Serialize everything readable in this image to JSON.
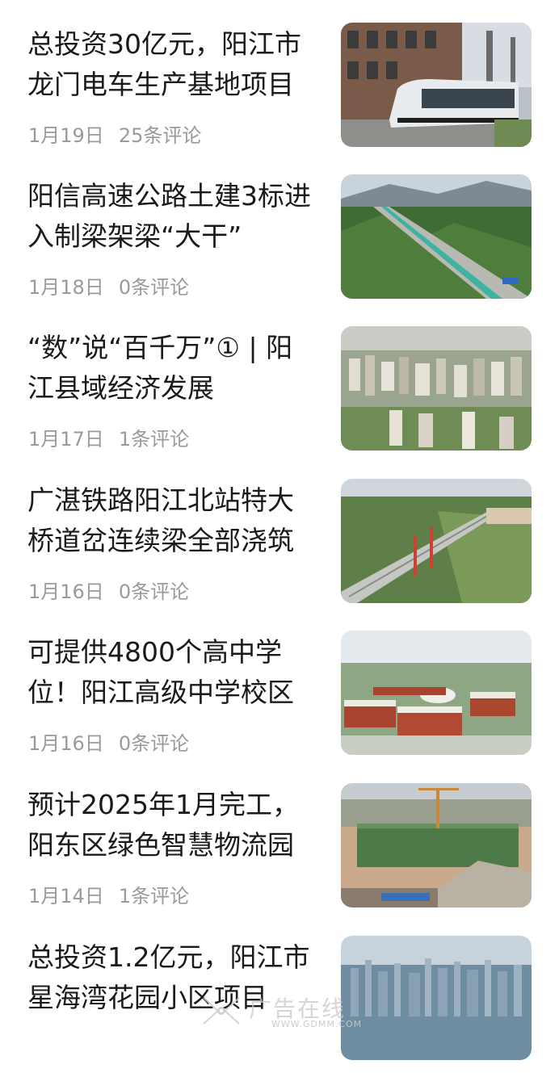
{
  "articles": [
    {
      "title": "总投资30亿元，阳江市龙门电车生产基地项目",
      "date": "1月19日",
      "comments": "25条评论",
      "image": "tram-street"
    },
    {
      "title": "阳信高速公路土建3标进入制梁架梁“大干”",
      "date": "1月18日",
      "comments": "0条评论",
      "image": "expressway-mountains"
    },
    {
      "title": "“数”说“百千万”① | 阳江县域经济发展",
      "date": "1月17日",
      "comments": "1条评论",
      "image": "city-aerial"
    },
    {
      "title": "广湛铁路阳江北站特大桥道岔连续梁全部浇筑",
      "date": "1月16日",
      "comments": "0条评论",
      "image": "railway-bridge"
    },
    {
      "title": "可提供4800个高中学位！阳江高级中学校区",
      "date": "1月16日",
      "comments": "0条评论",
      "image": "school-campus"
    },
    {
      "title": "预计2025年1月完工，阳东区绿色智慧物流园",
      "date": "1月14日",
      "comments": "1条评论",
      "image": "construction-site"
    },
    {
      "title": "总投资1.2亿元，阳江市星海湾花园小区项目",
      "date": "",
      "comments": "",
      "image": "skyline"
    }
  ],
  "watermark": {
    "text": "广告在线",
    "url": "WWW.GDMM.COM"
  }
}
